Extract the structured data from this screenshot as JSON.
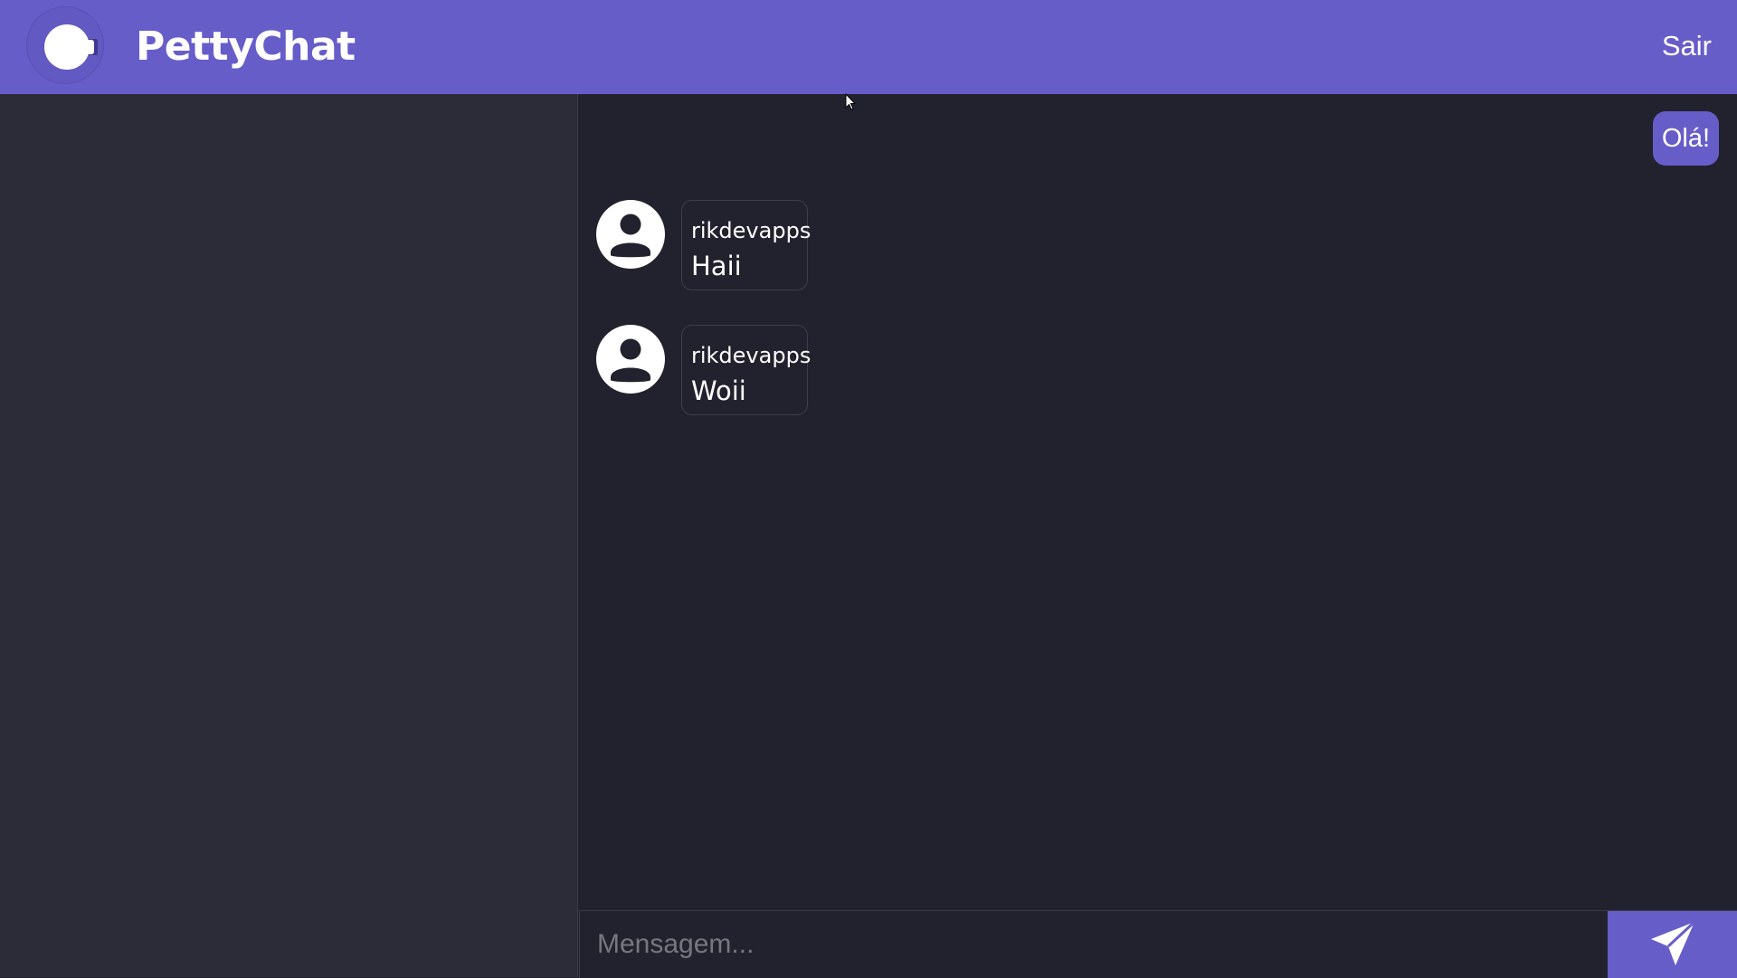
{
  "header": {
    "app_title": "PettyChat",
    "logout_label": "Sair",
    "logo_icon": "logo-icon"
  },
  "chat": {
    "own_messages": [
      {
        "text": "Olá!"
      }
    ],
    "messages": [
      {
        "sender": "rikdevapps",
        "text": "Haii",
        "avatar_icon": "user-avatar-icon"
      },
      {
        "sender": "rikdevapps",
        "text": "Woii",
        "avatar_icon": "user-avatar-icon"
      }
    ]
  },
  "composer": {
    "placeholder": "Mensagem...",
    "value": "",
    "send_icon": "send-icon"
  },
  "colors": {
    "accent": "#675dc9",
    "sidebar_bg": "#2c2c38",
    "chat_bg": "#22222e",
    "text": "#ffffff"
  }
}
